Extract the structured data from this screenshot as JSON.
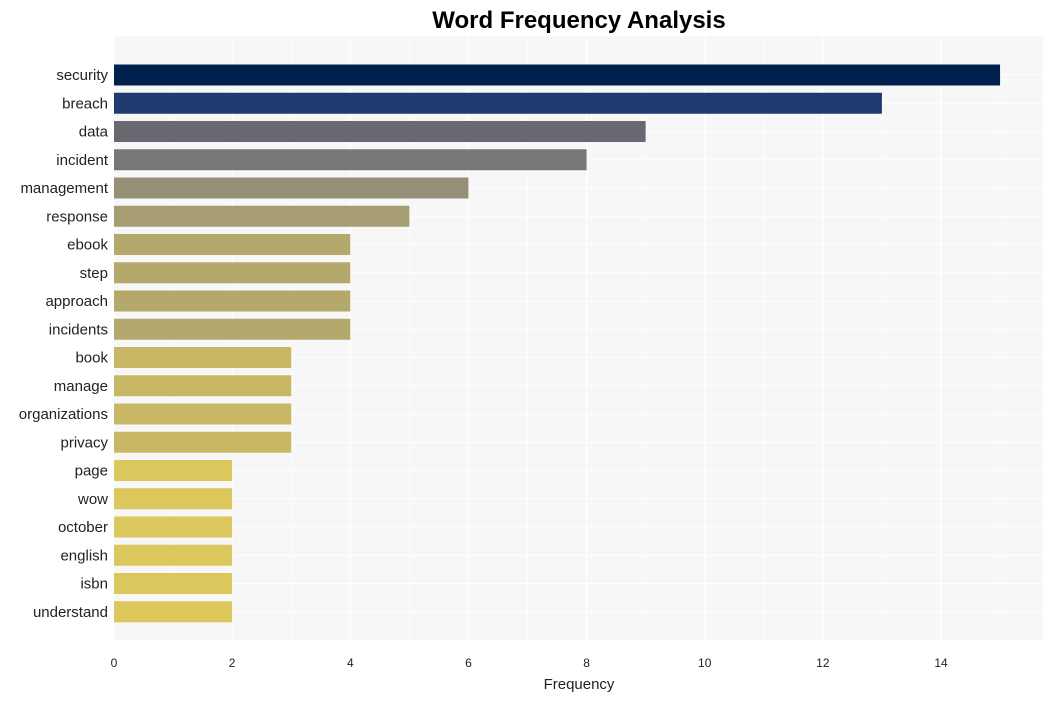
{
  "chart_data": {
    "type": "bar",
    "orientation": "horizontal",
    "title": "Word Frequency Analysis",
    "xlabel": "Frequency",
    "ylabel": "",
    "xlim": [
      0,
      15.7
    ],
    "xticks": [
      0,
      2,
      4,
      6,
      8,
      10,
      12,
      14
    ],
    "grid": true,
    "legend": "none",
    "categories": [
      "security",
      "breach",
      "data",
      "incident",
      "management",
      "response",
      "ebook",
      "step",
      "approach",
      "incidents",
      "book",
      "manage",
      "organizations",
      "privacy",
      "page",
      "wow",
      "october",
      "english",
      "isbn",
      "understand"
    ],
    "values": [
      15,
      13,
      9,
      8,
      6,
      5,
      4,
      4,
      4,
      4,
      3,
      3,
      3,
      3,
      2,
      2,
      2,
      2,
      2,
      2
    ],
    "colors": [
      "#00204e",
      "#1f3a70",
      "#676870",
      "#77777a",
      "#958f78",
      "#a69d75",
      "#b5a86d",
      "#b5a86d",
      "#b5a86d",
      "#b5a86d",
      "#c8b866",
      "#c8b866",
      "#c8b866",
      "#c8b866",
      "#dcc75d",
      "#dcc75d",
      "#dcc75d",
      "#dcc75d",
      "#dcc75d",
      "#dcc75d"
    ]
  },
  "colors": {
    "plot_background": "#f7f7f7",
    "gridline": "#ffffff"
  }
}
